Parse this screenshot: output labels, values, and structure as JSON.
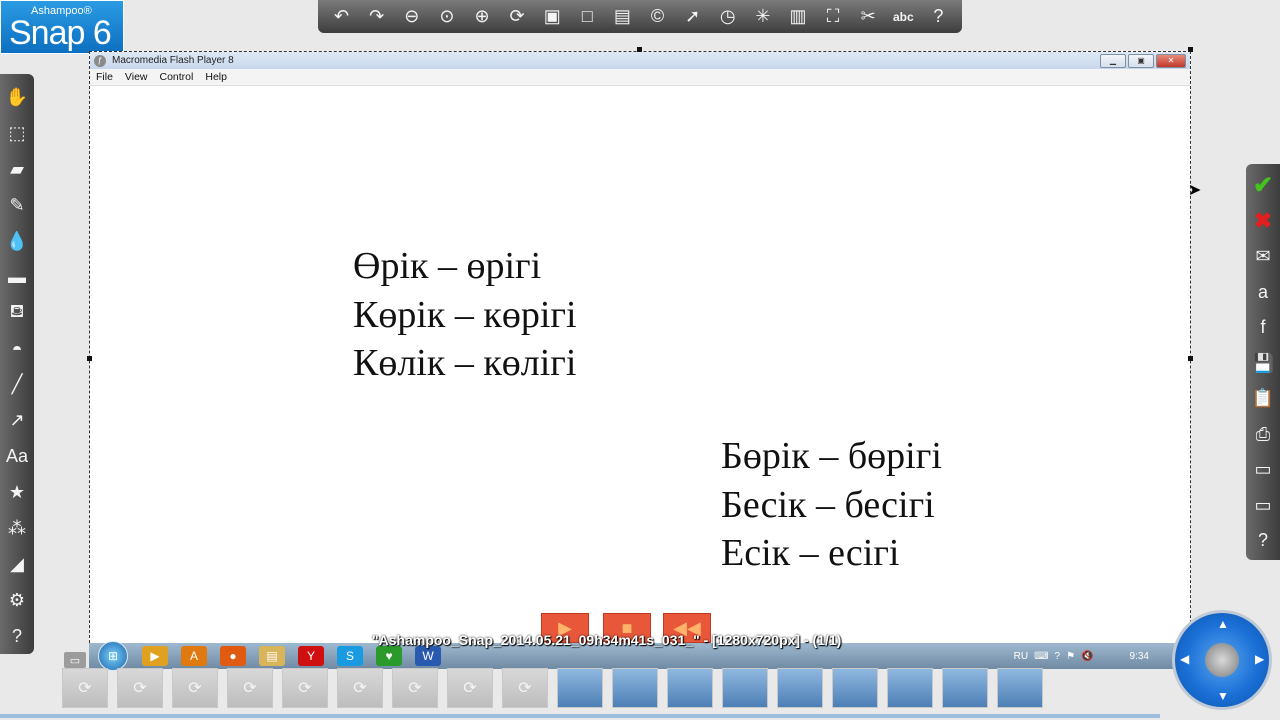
{
  "logo": {
    "brand": "Ashampoo®",
    "product": "Snap 6"
  },
  "top_toolbar": [
    {
      "name": "undo-icon",
      "glyph": "↶"
    },
    {
      "name": "redo-icon",
      "glyph": "↷"
    },
    {
      "name": "zoom-out-icon",
      "glyph": "⊖"
    },
    {
      "name": "zoom-1to1-icon",
      "glyph": "⊙"
    },
    {
      "name": "zoom-in-icon",
      "glyph": "⊕"
    },
    {
      "name": "rotate-icon",
      "glyph": "⟳"
    },
    {
      "name": "image-icon",
      "glyph": "▣"
    },
    {
      "name": "crop-frame-icon",
      "glyph": "□"
    },
    {
      "name": "cut-stripe-icon",
      "glyph": "▤"
    },
    {
      "name": "copyright-icon",
      "glyph": "©"
    },
    {
      "name": "pointer-icon",
      "glyph": "➚"
    },
    {
      "name": "clock-icon",
      "glyph": "◷"
    },
    {
      "name": "magic-icon",
      "glyph": "✳"
    },
    {
      "name": "document-icon",
      "glyph": "▥"
    },
    {
      "name": "fit-icon",
      "glyph": "⛶"
    },
    {
      "name": "scissors-icon",
      "glyph": "✂"
    },
    {
      "name": "spellcheck-icon",
      "glyph": "abc"
    },
    {
      "name": "help-icon",
      "glyph": "?"
    }
  ],
  "left_toolbar": [
    {
      "name": "hand-icon",
      "glyph": "✋"
    },
    {
      "name": "select-icon",
      "glyph": "⬚"
    },
    {
      "name": "eraser-icon",
      "glyph": "▰"
    },
    {
      "name": "pen-icon",
      "glyph": "✎"
    },
    {
      "name": "drop-icon",
      "glyph": "💧"
    },
    {
      "name": "panel-icon",
      "glyph": "▬"
    },
    {
      "name": "bucket-icon",
      "glyph": "⛾"
    },
    {
      "name": "shape-icon",
      "glyph": "◓"
    },
    {
      "name": "brush-icon",
      "glyph": "╱"
    },
    {
      "name": "arrow-icon",
      "glyph": "↗"
    },
    {
      "name": "text-icon",
      "glyph": "Aa"
    },
    {
      "name": "stamp-icon",
      "glyph": "★"
    },
    {
      "name": "numbering-icon",
      "glyph": "⁂"
    },
    {
      "name": "ruler-icon",
      "glyph": "◢"
    },
    {
      "name": "settings-icon",
      "glyph": "⚙"
    },
    {
      "name": "help-icon",
      "glyph": "?"
    }
  ],
  "right_toolbar": [
    {
      "name": "accept-icon",
      "glyph": "✔",
      "cls": "ok"
    },
    {
      "name": "cancel-icon",
      "glyph": "✖",
      "cls": "no"
    },
    {
      "name": "email-icon",
      "glyph": "✉"
    },
    {
      "name": "web-icon",
      "glyph": "a"
    },
    {
      "name": "facebook-icon",
      "glyph": "f"
    },
    {
      "name": "save-icon",
      "glyph": "💾"
    },
    {
      "name": "clipboard-icon",
      "glyph": "📋"
    },
    {
      "name": "print-icon",
      "glyph": "⎙"
    },
    {
      "name": "folder-icon",
      "glyph": "▭"
    },
    {
      "name": "open-folder-icon",
      "glyph": "▭"
    },
    {
      "name": "help-icon",
      "glyph": "?"
    }
  ],
  "flash_window": {
    "title": "Macromedia Flash Player 8",
    "menu": [
      "File",
      "View",
      "Control",
      "Help"
    ],
    "words_left": [
      "Өрік – өрігі",
      "Көрік – көрігі",
      "Көлік – көлігі"
    ],
    "words_right": [
      "Бөрік – бөрігі",
      "Бесік – бесігі",
      "Есік – есігі"
    ]
  },
  "caption": "\"Ashampoo_Snap_2014.05.21_09h34m41s_031_\" - [1280x720px] - (1/1)",
  "taskbar": {
    "apps": [
      {
        "name": "media-player-icon",
        "glyph": "▶",
        "color": "#e0a020"
      },
      {
        "name": "avast-icon",
        "glyph": "A",
        "color": "#e07a10"
      },
      {
        "name": "firefox-icon",
        "glyph": "●",
        "color": "#e05a10"
      },
      {
        "name": "explorer-icon",
        "glyph": "▤",
        "color": "#d8b45a"
      },
      {
        "name": "yandex-icon",
        "glyph": "Y",
        "color": "#d01010"
      },
      {
        "name": "skype-icon",
        "glyph": "S",
        "color": "#1a9ae0"
      },
      {
        "name": "agent-icon",
        "glyph": "♥",
        "color": "#2a9a2a"
      },
      {
        "name": "word-icon",
        "glyph": "W",
        "color": "#2a5ab0"
      }
    ],
    "language": "RU",
    "clock": "9:34"
  }
}
